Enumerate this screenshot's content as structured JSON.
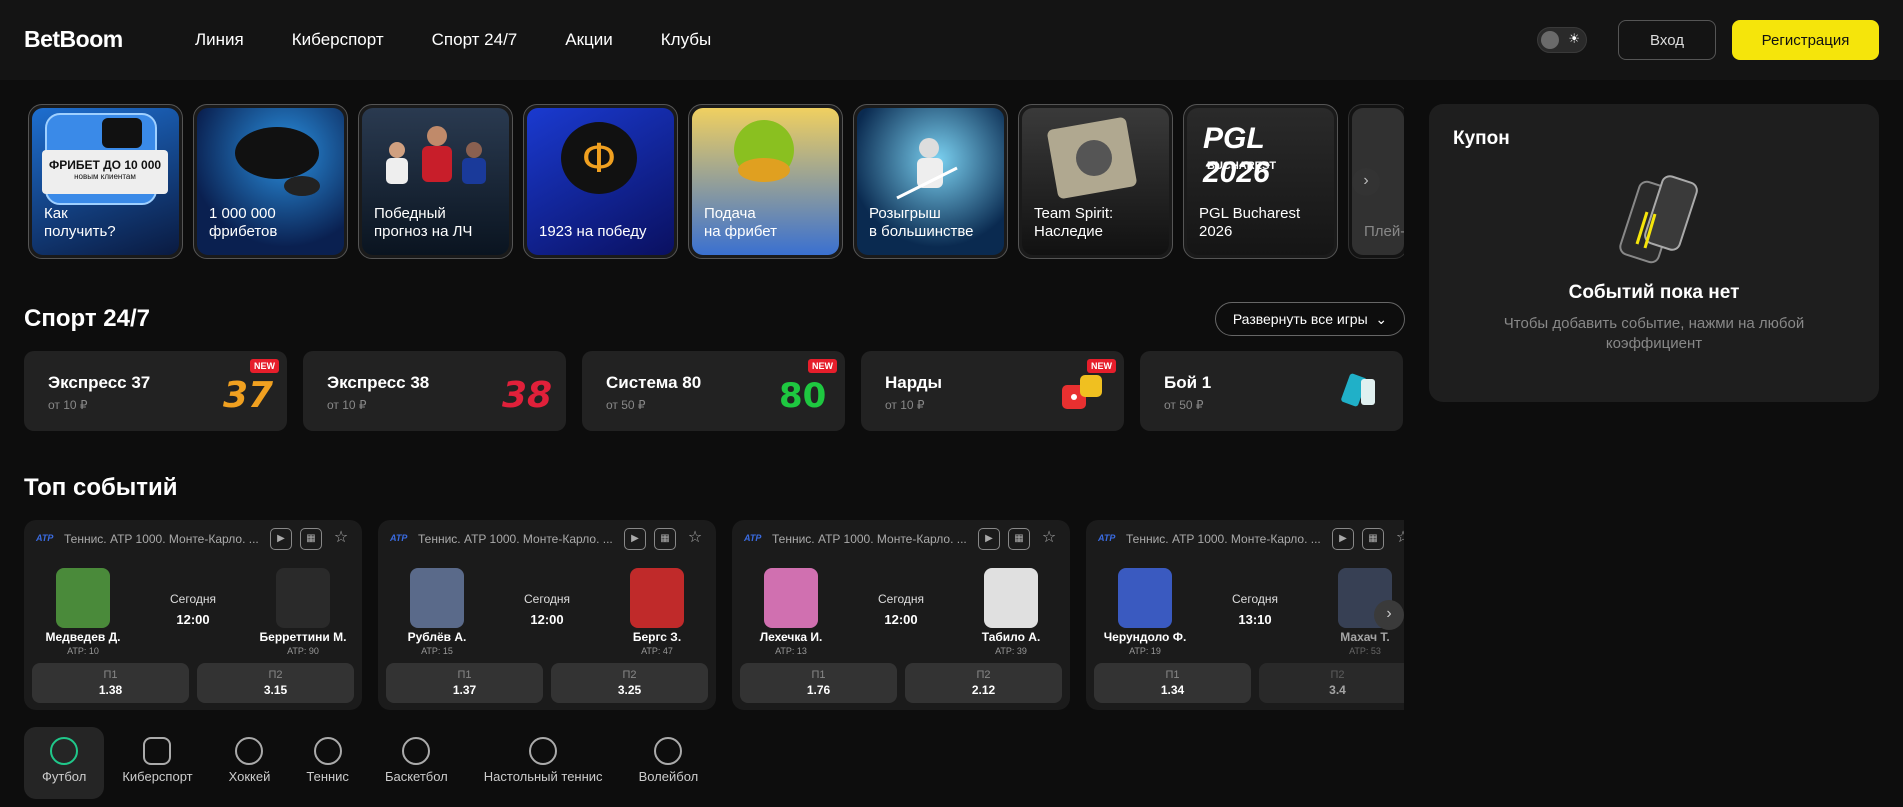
{
  "header": {
    "logo": "BetBoom",
    "nav": [
      "Линия",
      "Киберспорт",
      "Спорт 24/7",
      "Акции",
      "Клубы"
    ],
    "login": "Вход",
    "register": "Регистрация"
  },
  "promos": [
    {
      "label": "Как\nполучить?",
      "badge": "ФРИБЕТ ДО 10 000",
      "badge_sub": "новым клиентам"
    },
    {
      "label": "1 000 000\nфрибетов"
    },
    {
      "label": "Победный\nпрогноз на ЛЧ"
    },
    {
      "label": "1923 на победу"
    },
    {
      "label": "Подача\nна фрибет"
    },
    {
      "label": "Розыгрыш\nв большинстве"
    },
    {
      "label": "Team Spirit:\nНаследие"
    },
    {
      "label": "PGL Bucharest\n2026",
      "art": "PGL 2026",
      "art_sub": "BUCHAREST"
    },
    {
      "label": "Плей-..."
    }
  ],
  "sport247": {
    "title": "Спорт 24/7",
    "expand": "Развернуть все игры",
    "new_badge": "NEW",
    "games": [
      {
        "name": "Экспресс 37",
        "min": "от 10 ₽",
        "new": true,
        "color": "#f0a020"
      },
      {
        "name": "Экспресс 38",
        "min": "от 10 ₽",
        "new": false,
        "color": "#e0203a"
      },
      {
        "name": "Система 80",
        "min": "от 50 ₽",
        "new": true,
        "color": "#1ec840"
      },
      {
        "name": "Нарды",
        "min": "от 10 ₽",
        "new": true,
        "color": "#e83030"
      },
      {
        "name": "Бой 1",
        "min": "от 50 ₽",
        "new": false,
        "color": "#20b0c8"
      }
    ]
  },
  "top_events": {
    "title": "Топ событий",
    "league": "Теннис. ATP 1000. Монте-Карло. ...",
    "atp": "ATP",
    "date_label": "Сегодня",
    "p1_label": "П1",
    "p2_label": "П2",
    "events": [
      {
        "home": "Медведев Д.",
        "home_rank": "ATP: 10",
        "away": "Берреттини М.",
        "away_rank": "ATP: 90",
        "time": "12:00",
        "p1": "1.38",
        "p2": "3.15",
        "home_color": "#4a8a3a",
        "away_color": "#2a2a2a"
      },
      {
        "home": "Рублёв А.",
        "home_rank": "ATP: 15",
        "away": "Бергс З.",
        "away_rank": "ATP: 47",
        "time": "12:00",
        "p1": "1.37",
        "p2": "3.25",
        "home_color": "#5a6a8a",
        "away_color": "#c02a2a"
      },
      {
        "home": "Лехечка И.",
        "home_rank": "ATP: 13",
        "away": "Табило А.",
        "away_rank": "ATP: 39",
        "time": "12:00",
        "p1": "1.76",
        "p2": "2.12",
        "home_color": "#d070b0",
        "away_color": "#e0e0e0"
      },
      {
        "home": "Черундоло Ф.",
        "home_rank": "ATP: 19",
        "away": "Махач Т.",
        "away_rank": "ATP: 53",
        "time": "13:10",
        "p1": "1.34",
        "p2": "3.4",
        "home_color": "#3a5ac0",
        "away_color": "#4a5a7a"
      }
    ]
  },
  "sports": [
    {
      "label": "Футбол",
      "icon": "football-icon",
      "active": true
    },
    {
      "label": "Киберспорт",
      "icon": "gamepad-icon",
      "active": false
    },
    {
      "label": "Хоккей",
      "icon": "hockey-puck-icon",
      "active": false
    },
    {
      "label": "Теннис",
      "icon": "tennis-ball-icon",
      "active": false
    },
    {
      "label": "Баскетбол",
      "icon": "basketball-icon",
      "active": false
    },
    {
      "label": "Настольный теннис",
      "icon": "table-tennis-icon",
      "active": false
    },
    {
      "label": "Волейбол",
      "icon": "volleyball-icon",
      "active": false
    }
  ],
  "coupon": {
    "title": "Купон",
    "empty": "Событий пока нет",
    "hint": "Чтобы добавить событие, нажми на любой коэффициент"
  },
  "colors": {
    "accent": "#f5e50b",
    "active_sport": "#20c78a",
    "background": "#0d0d0d"
  }
}
